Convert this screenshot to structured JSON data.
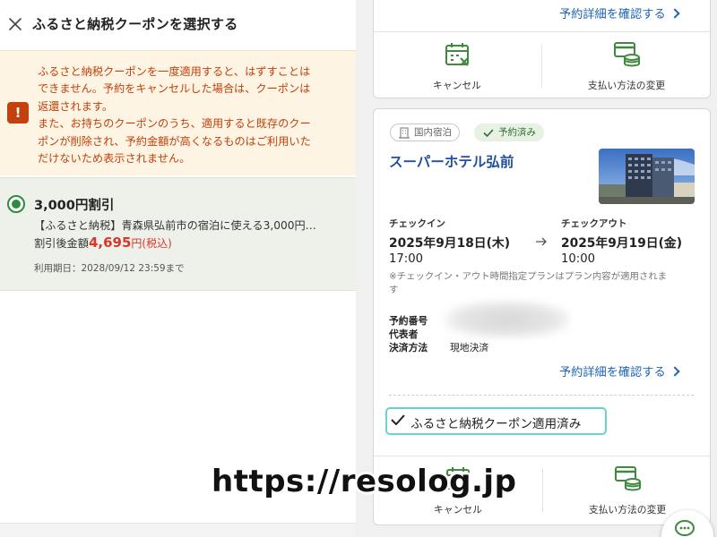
{
  "left_panel": {
    "title": "ふるさと納税クーポンを選択する",
    "notice_lines": [
      "ふるさと納税クーポンを一度適用すると、はずすことは",
      "できません。予約をキャンセルした場合は、クーポンは",
      "返還されます。",
      "また、お持ちのクーポンのうち、適用すると既存のクー",
      "ポンが削除され、予約金額が高くなるものはご利用いた",
      "だけないため表示されません。"
    ],
    "warning_icon_glyph": "!",
    "coupon": {
      "title": "3,000円割引",
      "description": "【ふるさと納税】青森県弘前市の宿泊に使える3,000円…",
      "after_label": "割引後金額",
      "after_price": "4,695",
      "after_unit": "円(税込)",
      "expiry": "利用期日：2028/09/12 23:59まで",
      "selected": true
    }
  },
  "right_panel": {
    "top_card": {
      "details_link": "予約詳細を確認する",
      "actions": [
        {
          "label": "キャンセル",
          "icon": "calendar-cancel-icon"
        },
        {
          "label": "支払い方法の変更",
          "icon": "payment-change-icon"
        }
      ]
    },
    "reservation": {
      "tags": {
        "category": "国内宿泊",
        "status": "予約済み"
      },
      "hotel_name": "スーパーホテル弘前",
      "checkin_label": "チェックイン",
      "checkin_date": "2025年9月18日(木)",
      "checkin_time": "17:00",
      "checkout_label": "チェックアウト",
      "checkout_date": "2025年9月19日(金)",
      "checkout_time": "10:00",
      "note_lines": [
        "※チェックイン・アウト時間指定プランはプラン内容が適用されま",
        "す"
      ],
      "info_labels": [
        "予約番号",
        "代表者",
        "決済方法"
      ],
      "payment_value": "現地決済",
      "details_link": "予約詳細を確認する",
      "coupon_applied": "ふるさと納税クーポン適用済み",
      "actions": [
        {
          "label": "キャンセル",
          "icon": "calendar-cancel-icon"
        },
        {
          "label": "支払い方法の変更",
          "icon": "payment-change-icon"
        }
      ]
    }
  },
  "watermark": "https://resolog.jp",
  "colors": {
    "notice_bg": "#fdf4e3",
    "notice_text": "#c2410c",
    "coupon_bg": "#eef1ea",
    "radio_green": "#2e8b3d",
    "price_red": "#d9362b",
    "link_blue": "#1f64b4",
    "hotel_blue": "#1f4f9e",
    "icon_green": "#3f8a3f",
    "applied_border": "#6ad2d7"
  }
}
